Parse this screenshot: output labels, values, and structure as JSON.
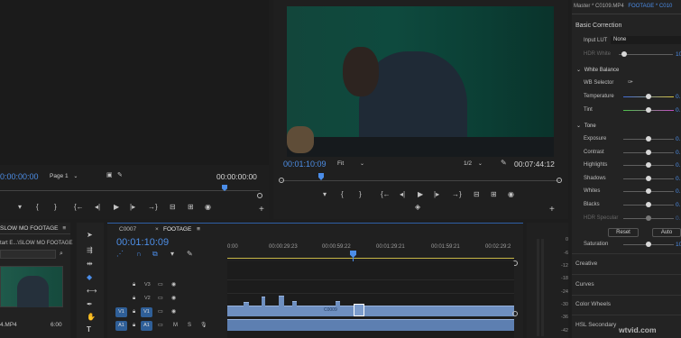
{
  "source_monitor": {
    "timecode_left": "0:00:00:00",
    "page_select": "Page 1",
    "timecode_right": "00:00:00:00"
  },
  "program_monitor": {
    "timecode": "00:01:10:09",
    "fit": "Fit",
    "resolution": "1/2",
    "duration": "00:07:44:12"
  },
  "project_panel": {
    "tab": "SLOW MO FOOTAGE",
    "path": "tart E...\\SLOW MO FOOTAGE",
    "clip_name": "4.MP4",
    "clip_duration": "6:00"
  },
  "timeline": {
    "tabs": [
      {
        "label": "C0007"
      },
      {
        "label": "FOOTAGE"
      }
    ],
    "timecode": "00:01:10:09",
    "ruler": [
      "0:00",
      "00:00:29:23",
      "00:00:59:22",
      "00:01:29:21",
      "00:01:59:21",
      "00:02:29:2"
    ],
    "tracks": [
      {
        "src": "",
        "name": "V3"
      },
      {
        "src": "",
        "name": "V2"
      },
      {
        "src": "V1",
        "name": "V1"
      },
      {
        "src": "A1",
        "name": "A1"
      }
    ],
    "audio_flags": {
      "m": "M",
      "s": "S"
    },
    "clip_label": "C0009"
  },
  "meter": {
    "labels": [
      "0",
      "-6",
      "-12",
      "-18",
      "-24",
      "-30",
      "-36",
      "-42"
    ]
  },
  "lumetri": {
    "header": "Master * C0109.MP4",
    "header_link": "FOOTAGE * C010",
    "section": "Basic Correction",
    "input_lut_label": "Input LUT",
    "input_lut_value": "None",
    "hdr_white_label": "HDR White",
    "hdr_white_value": "10",
    "white_balance": "White Balance",
    "wb_selector": "WB Selector",
    "temperature": {
      "label": "Temperature",
      "value": "0."
    },
    "tint": {
      "label": "Tint",
      "value": "0."
    },
    "tone": "Tone",
    "tone_rows": [
      {
        "label": "Exposure",
        "value": "0."
      },
      {
        "label": "Contrast",
        "value": "0."
      },
      {
        "label": "Highlights",
        "value": "0."
      },
      {
        "label": "Shadows",
        "value": "0."
      },
      {
        "label": "Whites",
        "value": "0."
      },
      {
        "label": "Blacks",
        "value": "0."
      },
      {
        "label": "HDR Specular",
        "value": "0."
      }
    ],
    "reset": "Reset",
    "auto": "Auto",
    "saturation": {
      "label": "Saturation",
      "value": "10"
    },
    "sections": [
      "Creative",
      "Curves",
      "Color Wheels",
      "HSL Secondary"
    ]
  },
  "watermark": "wtvid.com"
}
